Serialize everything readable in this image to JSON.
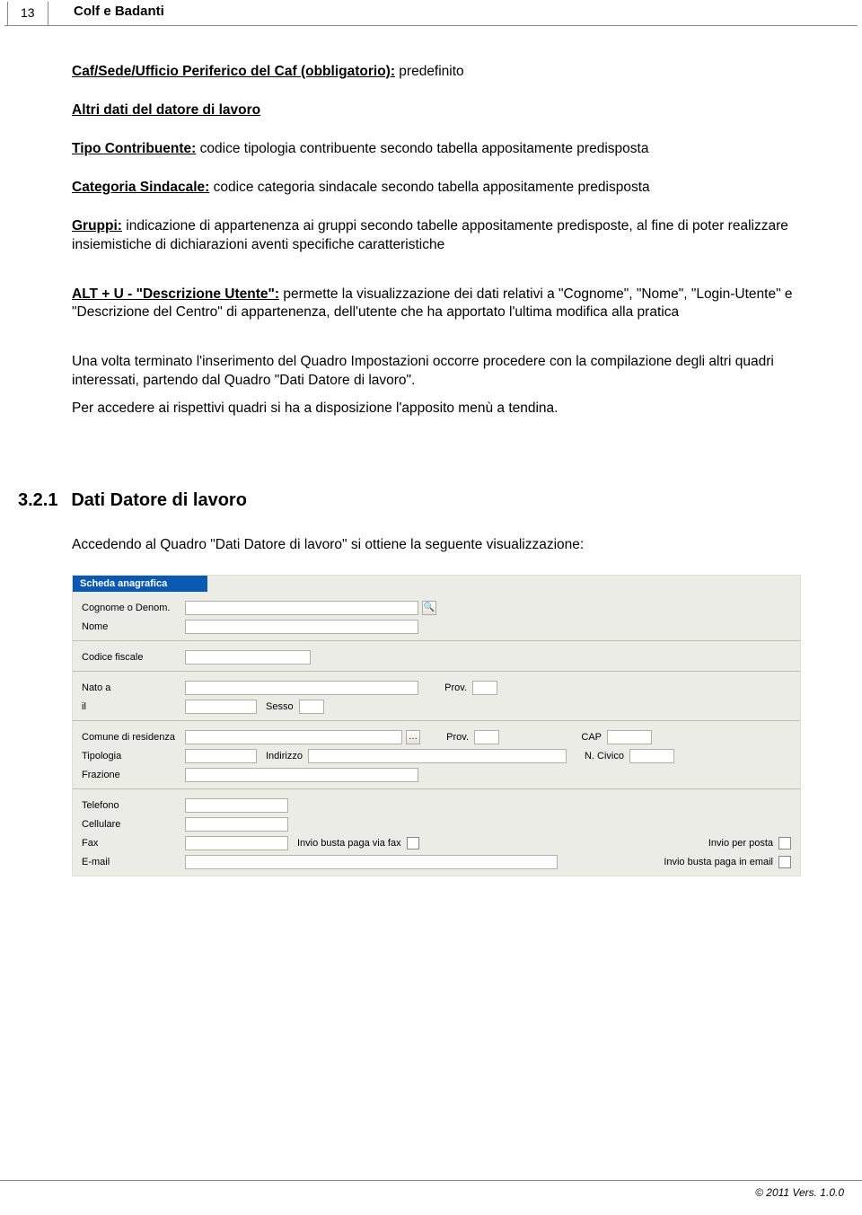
{
  "page_number": "13",
  "doc_title": "Colf e Badanti",
  "text": {
    "caf_label": "Caf/Sede/Ufficio Periferico del Caf (obbligatorio):",
    "caf_val": " predefinito",
    "altri_dati": "Altri dati del datore di lavoro",
    "tipo_label": "Tipo Contribuente:",
    "tipo_val": " codice tipologia contribuente secondo tabella appositamente predisposta",
    "cat_label": "Categoria Sindacale:",
    "cat_val": " codice categoria sindacale secondo tabella appositamente predisposta",
    "gruppi_label": "Gruppi:",
    "gruppi_val": " indicazione di appartenenza ai gruppi secondo tabelle appositamente predisposte, al fine di poter realizzare insiemistiche di dichiarazioni aventi specifiche caratteristiche",
    "alt_label": "ALT + U - \"Descrizione Utente\":",
    "alt_val": " permette la visualizzazione dei dati relativi a \"Cognome\", \"Nome\", \"Login-Utente\" e \"Descrizione del Centro\" di appartenenza, dell'utente che ha apportato l'ultima modifica alla pratica",
    "p1": "Una volta terminato l'inserimento del Quadro Impostazioni occorre procedere con la compilazione degli altri quadri interessati, partendo dal Quadro \"Dati Datore di lavoro\".",
    "p2": "Per accedere ai rispettivi quadri si ha a disposizione l'apposito menù a tendina.",
    "section_num": "3.2.1",
    "section_title": "Dati Datore di lavoro",
    "p3": "Accedendo al Quadro \"Dati Datore di lavoro\" si ottiene la seguente visualizzazione:"
  },
  "form": {
    "header": "Scheda anagrafica",
    "labels": {
      "cognome": "Cognome o Denom.",
      "nome": "Nome",
      "cf": "Codice fiscale",
      "nato": "Nato a",
      "prov": "Prov.",
      "il": "il",
      "sesso": "Sesso",
      "comune": "Comune di residenza",
      "cap": "CAP",
      "tipologia": "Tipologia",
      "indirizzo": "Indirizzo",
      "ncivico": "N. Civico",
      "frazione": "Frazione",
      "telefono": "Telefono",
      "cellulare": "Cellulare",
      "fax": "Fax",
      "email": "E-mail",
      "invio_fax": "Invio busta paga via fax",
      "invio_posta": "Invio per posta",
      "invio_email": "Invio busta paga in email"
    }
  },
  "footer": "© 2011 Vers. 1.0.0"
}
